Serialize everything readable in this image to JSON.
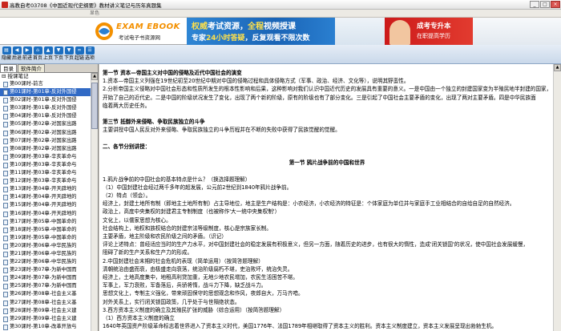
{
  "window": {
    "title": "高教自考03708《中国近现代史纲要》教材讲义笔记与历年真题集",
    "minimize": "_",
    "maximize": "□",
    "close": "×"
  },
  "menubar": {
    "label": "显色"
  },
  "banner": {
    "logo_title": "EXAM EBOOK",
    "logo_subtitle": "考试电子书资源网",
    "ad1_line1_a": "权威",
    "ad1_line1_b": "考试资源，",
    "ad1_line1_c": "全程",
    "ad1_line1_d": "视频授课",
    "ad1_line2_a": "专家",
    "ad1_line2_b": "24小时答疑",
    "ad1_line2_c": "，反复观看不限次数",
    "ad2_line1": "成考专升本",
    "ad2_line2": "在职提高学历"
  },
  "toolbar": {
    "buttons": [
      "隐藏",
      "后退",
      "前进",
      "首页",
      "上页",
      "下页",
      "下页",
      "超链",
      "选项"
    ]
  },
  "left_panel": {
    "tabs": [
      "目录",
      "软件简介"
    ],
    "root": "授课笔记",
    "items": [
      "第00课时-前言",
      "第01课时-第01章-反对外国侵",
      "第02课时-第01章-反对外国侵",
      "第03课时-第01章-反对外国侵",
      "第04课时-第01章-反对外国侵",
      "第05课时-第02章-对国家出路",
      "第06课时-第02章-对国家出路",
      "第07课时-第02章-对国家出路",
      "第08课时-第02章-对国家出路",
      "第09课时-第03章-辛亥革命与",
      "第10课时-第03章-辛亥革命与",
      "第11课时-第03章-辛亥革命与",
      "第12课时-第03章-辛亥革命与",
      "第13课时-第04章-开天辟地的",
      "第14课时-第04章-开天辟地的",
      "第15课时-第04章-开天辟地的",
      "第16课时-第04章-开天辟地的",
      "第17课时-第05章-中国革命的",
      "第18课时-第05章-中国革命的",
      "第19课时-第05章-中国革命的",
      "第20课时-第06章-中华民族的",
      "第21课时-第06章-中华民族的",
      "第22课时-第06章-中华民族的",
      "第23课时-第07章-为新中国而",
      "第24课时-第07章-为新中国而",
      "第25课时-第07章-为新中国而",
      "第26课时-第08章-社会主义基",
      "第27课时-第08章-社会主义基",
      "第28课时-第09章-社会主义建",
      "第29课时-第09章-社会主义建",
      "第30课时-第10章-改革开放与",
      "第31课时-第10章-改革开放与"
    ],
    "selected_index": 1
  },
  "content": {
    "lines": [
      {
        "t": "第一节  资本—帝国主义对中国的侵略及近代中国社会的演变",
        "bold": true
      },
      {
        "t": "1.资本—帝国主义列强在19世纪初至20世纪中期对中国的侵略过程和具体侵略方式（军事、政治、经济、文化等），说明其野蛮性。"
      },
      {
        "t": "2.分析帝国主义侵略对中国社会形态和性质所发生的根本性影响和后果，这种影响对我们认识中国近代历史的发展具有重要的意义。一是中国由一个独立的封建国家变为半殖民地半封建的国家，中国变成了一个半殖民地半封建的国家，"
      },
      {
        "t": "开始了自己的近代史。二是中国的阶级状况发生了变化，出现了两个新的阶级，原有的阶级也有了部分变化。三是引起了中国社会主要矛盾的变化，出现了两对主要矛盾。四是中华民族面"
      },
      {
        "t": "临着两大历史任务。"
      },
      {
        "t": ""
      },
      {
        "t": "第三节  抵御外来侵略、争取民族独立的斗争",
        "bold": true
      },
      {
        "t": "主要讲授中国人民反对外来侵略、争取民族独立的斗争历程并在不断的失败中获得了民族觉醒的觉醒。"
      },
      {
        "t": ""
      },
      {
        "t": "二、各节分别讲授：",
        "bold": true
      },
      {
        "t": ""
      },
      {
        "t": "第一节  鸦片战争前的中国和世界",
        "bold": true,
        "center": true
      },
      {
        "t": ""
      },
      {
        "t": "1.鸦片战争前的中国社会的基本特点是什么？（换选择题理解）"
      },
      {
        "t": "（1）中国封建社会经过两千多年的超发展，公元前2世纪到1840年鸦片战争前。"
      },
      {
        "t": "（2）特点（领会）。"
      },
      {
        "t": "经济上，封建土地所有制（即地主土地所有制）占主导地位，地主是生产结构是：小农经济，小农经济的特征是：个体家庭为单位并与家庭手工业相结合的自给自足的自然经济。"
      },
      {
        "t": "政治上，高度中央集权的封建君主专制制度（也被称作'大一统中央集权制'）"
      },
      {
        "t": "文化上，以儒家思想为核心。"
      },
      {
        "t": "社会结构上，地权和族权结合的封建宗法等级制度，核心是宗族家长制。"
      },
      {
        "t": "主要矛盾，地主阶级和农民阶级之间的矛盾。（识记）"
      },
      {
        "t": "评论上述特点：曾经适应当时的生产力水平，对中国封建社会的稳定发展有积极意义，但另一方面，随着历史的进步，也有很大的惰性，造成'闭关锁国'的状况，使中国社会发展缓慢，"
      },
      {
        "t": "阻碍了新的生产关系和生产力的形成。"
      },
      {
        "t": "2.中国封建社会末期的社会危机的表现（简单运用）（按简答题理解）"
      },
      {
        "t": "清朝统治由盛而衰，由极盛走向衰落，统治阶级腐朽不堪，吏治败坏，统治失灵。"
      },
      {
        "t": "经济上，土地高度集中，地租高利贷加重，无地少地农民增加，农民生活困苦不堪。"
      },
      {
        "t": "军事上，军力衰败，军备落后，兵骄将惰，战斗力下降，缺乏战斗力。"
      },
      {
        "t": "思想文化上，专制主义强化，带来顽固保守的思想观念和作风，夜郎自大，万马齐喑。"
      },
      {
        "t": "对外关系上，实行闭关锁国政策，几乎处于与世隔绝状态。"
      },
      {
        "t": "3.西方资本主义制度的确立及其殖民扩张的威胁（综合运用）（按简答题理解）"
      },
      {
        "t": "（1）西方资本主义制度的确立"
      },
      {
        "t": "1640年英国资产阶级革命标志着世界进入了资本主义时代，美国1776年、法国1789年相继取得了资本主义的胜利。资本主义制度建立，资本主义发展呈现出勃勃生机。"
      }
    ]
  }
}
